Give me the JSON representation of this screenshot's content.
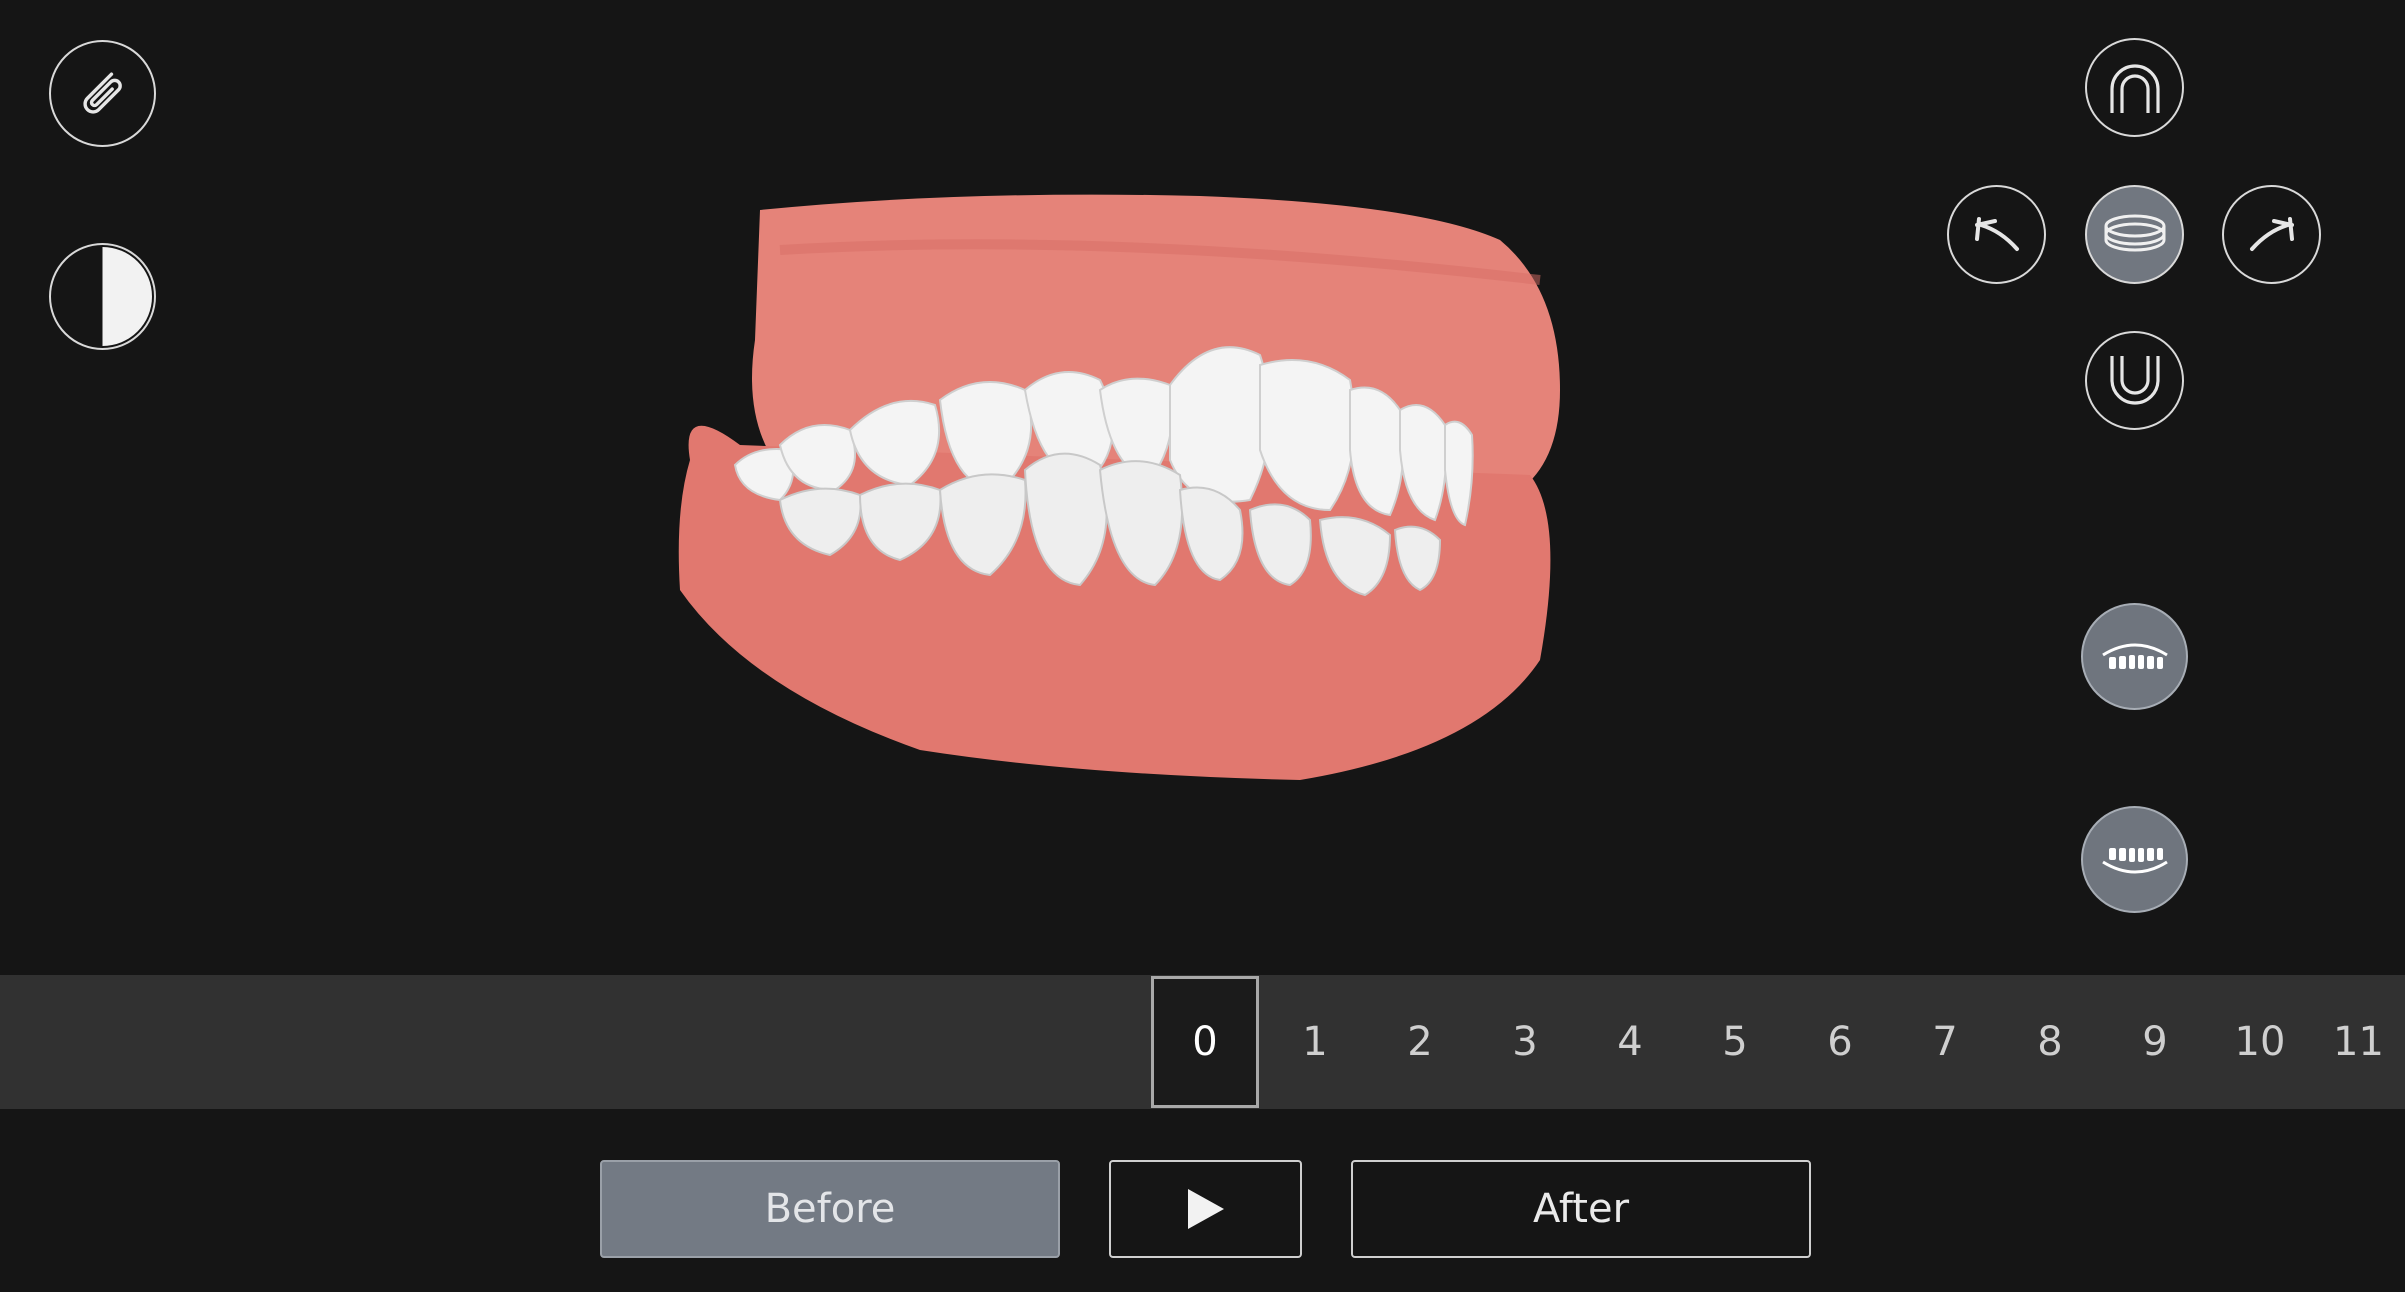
{
  "toolbar_left": {
    "attach": {
      "icon": "paperclip-icon"
    },
    "contrast": {
      "icon": "contrast-icon"
    }
  },
  "view_controls": {
    "upper_arch": {
      "icon": "upper-arch-icon"
    },
    "rotate_left": {
      "icon": "rotate-left-arrow-icon"
    },
    "occlusal_center": {
      "icon": "occlusal-view-icon",
      "selected": true
    },
    "rotate_right": {
      "icon": "rotate-right-arrow-icon"
    },
    "lower_arch": {
      "icon": "lower-arch-icon"
    },
    "show_upper_teeth": {
      "icon": "upper-teeth-icon"
    },
    "show_lower_teeth": {
      "icon": "lower-teeth-icon"
    }
  },
  "timeline": {
    "selected": "0",
    "steps": [
      "0",
      "1",
      "2",
      "3",
      "4",
      "5",
      "6",
      "7",
      "8",
      "9",
      "10",
      "11"
    ]
  },
  "actions": {
    "before_label": "Before",
    "play_icon": "play-icon",
    "after_label": "After"
  },
  "colors": {
    "background": "#151515",
    "gum": "#e8857c",
    "teeth": "#f2f2f2",
    "timeline_bar": "#313131",
    "before_button": "#737a84"
  }
}
